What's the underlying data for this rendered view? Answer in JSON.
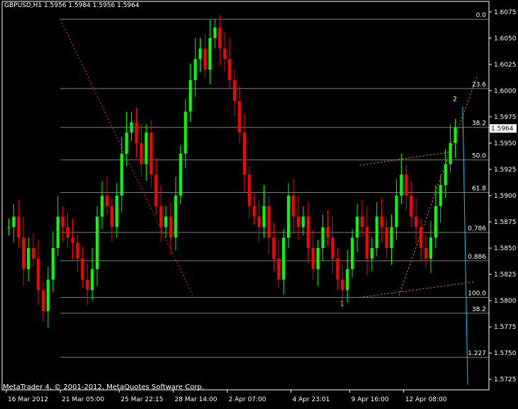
{
  "header": {
    "symbol_text": "GBPUSD,H1",
    "ohlc_text": "1.5956 1.5984 1.5956 1.5964"
  },
  "footer": {
    "copyright": "MetaTrader 4, © 2001-2012, MetaQuotes Software Corp."
  },
  "colors": {
    "background": "#000000",
    "bull": "#00ff00",
    "bear": "#ff0000",
    "fib": "#808080",
    "fib_label": "#808080",
    "channel": "#ff9900",
    "trendline": "#00ccff",
    "wave_label": "#00ffff",
    "red_dotted": "#ff3300"
  },
  "chart_data": {
    "type": "candlestick",
    "y_ticks": [
      "1.6075",
      "1.6050",
      "1.6025",
      "1.6000",
      "1.5975",
      "1.5950",
      "1.5925",
      "1.5900",
      "1.5875",
      "1.5850",
      "1.5825",
      "1.5800",
      "1.5775",
      "1.5750",
      "1.5725"
    ],
    "ylim": [
      1.5715,
      1.6085
    ],
    "current_price": "1.5964",
    "x_ticks": [
      "16 Mar 2012",
      "21 Mar 05:00",
      "25 Mar 22:15",
      "28 Mar 14:00",
      "2 Apr 07:00",
      "4 Apr 23:01",
      "9 Apr 16:00",
      "12 Apr 08:00"
    ],
    "fib_levels": [
      {
        "label": "0.0",
        "price": 1.6068
      },
      {
        "label": "23.6",
        "price": 1.6002
      },
      {
        "label": "38.2",
        "price": 1.5965
      },
      {
        "label": "50.0",
        "price": 1.5934
      },
      {
        "label": "61.8",
        "price": 1.5903
      },
      {
        "label": "0.786",
        "price": 1.5865
      },
      {
        "label": "0.886",
        "price": 1.5838
      },
      {
        "label": "100.0",
        "price": 1.5803
      },
      {
        "label": "38.2",
        "price": 1.5788
      },
      {
        "label": "1.227",
        "price": 1.5746
      }
    ],
    "wave_labels": [
      {
        "text": "1",
        "bar": 68,
        "price": 1.5795
      },
      {
        "text": "2",
        "bar": 91,
        "price": 1.599
      }
    ],
    "candles_seed_path": [
      1.587,
      1.588,
      1.586,
      1.583,
      1.585,
      1.584,
      1.581,
      1.579,
      1.582,
      1.585,
      1.588,
      1.587,
      1.586,
      1.5855,
      1.584,
      1.582,
      1.581,
      1.583,
      1.588,
      1.59,
      1.589,
      1.587,
      1.59,
      1.594,
      1.596,
      1.597,
      1.595,
      1.593,
      1.596,
      1.592,
      1.589,
      1.587,
      1.588,
      1.586,
      1.59,
      1.594,
      1.598,
      1.601,
      1.603,
      1.604,
      1.602,
      1.605,
      1.606,
      1.604,
      1.603,
      1.601,
      1.599,
      1.596,
      1.592,
      1.589,
      1.588,
      1.587,
      1.589,
      1.586,
      1.584,
      1.582,
      1.586,
      1.59,
      1.588,
      1.587,
      1.588,
      1.585,
      1.583,
      1.585,
      1.587,
      1.586,
      1.584,
      1.582,
      1.581,
      1.583,
      1.586,
      1.588,
      1.587,
      1.584,
      1.585,
      1.588,
      1.587,
      1.585,
      1.587,
      1.59,
      1.592,
      1.59,
      1.588,
      1.587,
      1.585,
      1.584,
      1.586,
      1.589,
      1.591,
      1.593,
      1.595,
      1.5965
    ]
  }
}
